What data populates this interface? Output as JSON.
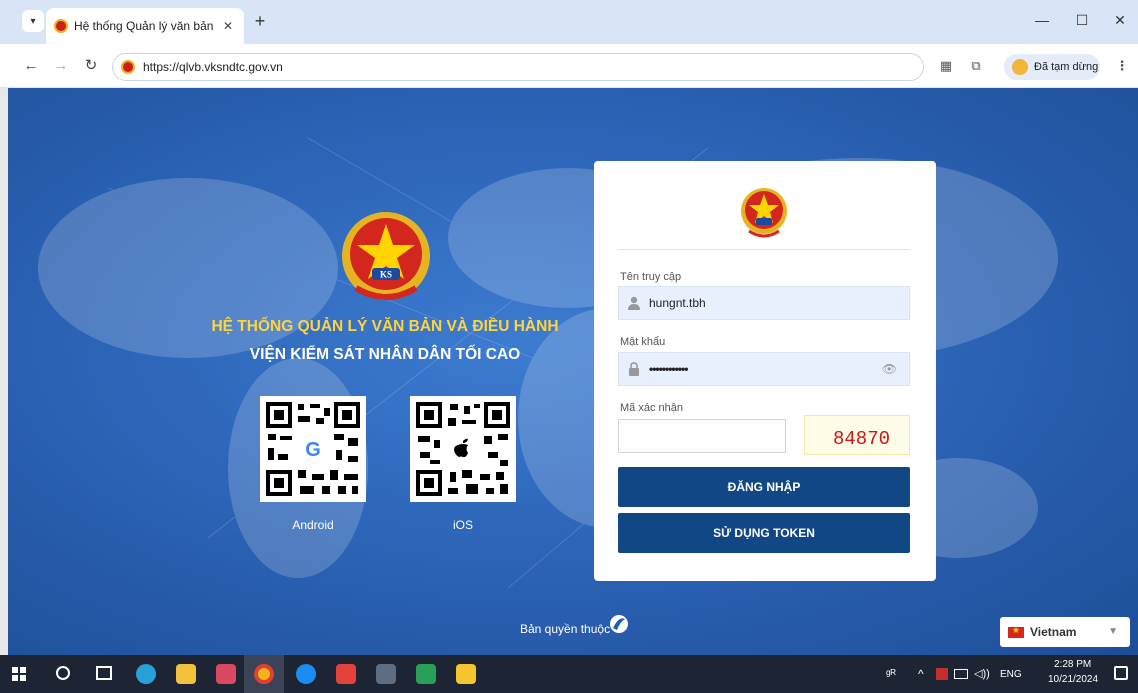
{
  "browser": {
    "tab_title": "Hệ thống Quản lý văn bản và đ",
    "tab_close": "✕",
    "new_tab": "+",
    "url": "https://qlvb.vksndtc.gov.vn",
    "profile_label": "Đã tạm dừng",
    "window_controls": [
      "—",
      "☐",
      "✕"
    ]
  },
  "hero": {
    "title": "HỆ THỐNG QUẢN LÝ VĂN BẢN VÀ ĐIỀU HÀNH",
    "subtitle": "VIỆN KIỂM SÁT NHÂN DÂN TỐI CAO",
    "emblem_text": "KS",
    "qr_codes": [
      {
        "label": "Android",
        "icon": "google-g-icon"
      },
      {
        "label": "iOS",
        "icon": "apple-icon"
      }
    ]
  },
  "login": {
    "username_label": "Tên truy cập",
    "username_value": "hungnt.tbh",
    "password_label": "Mật khẩu",
    "password_value": "••••••••••••",
    "captcha_label": "Mã xác nhận",
    "captcha_value": "",
    "captcha_text": "84870",
    "login_button": "ĐĂNG NHẬP",
    "token_button": "SỬ DỤNG TOKEN"
  },
  "footer": {
    "copyright": "Bản quyền thuộc"
  },
  "language": {
    "selected": "Vietnam"
  },
  "taskbar": {
    "keyboard_lang": "ENG",
    "time": "2:28 PM",
    "date": "10/21/2024"
  },
  "colors": {
    "page_blue": "#2d65b8",
    "title_yellow": "#ffd43b",
    "button_navy": "#124785",
    "emblem_red": "#c8201a"
  }
}
